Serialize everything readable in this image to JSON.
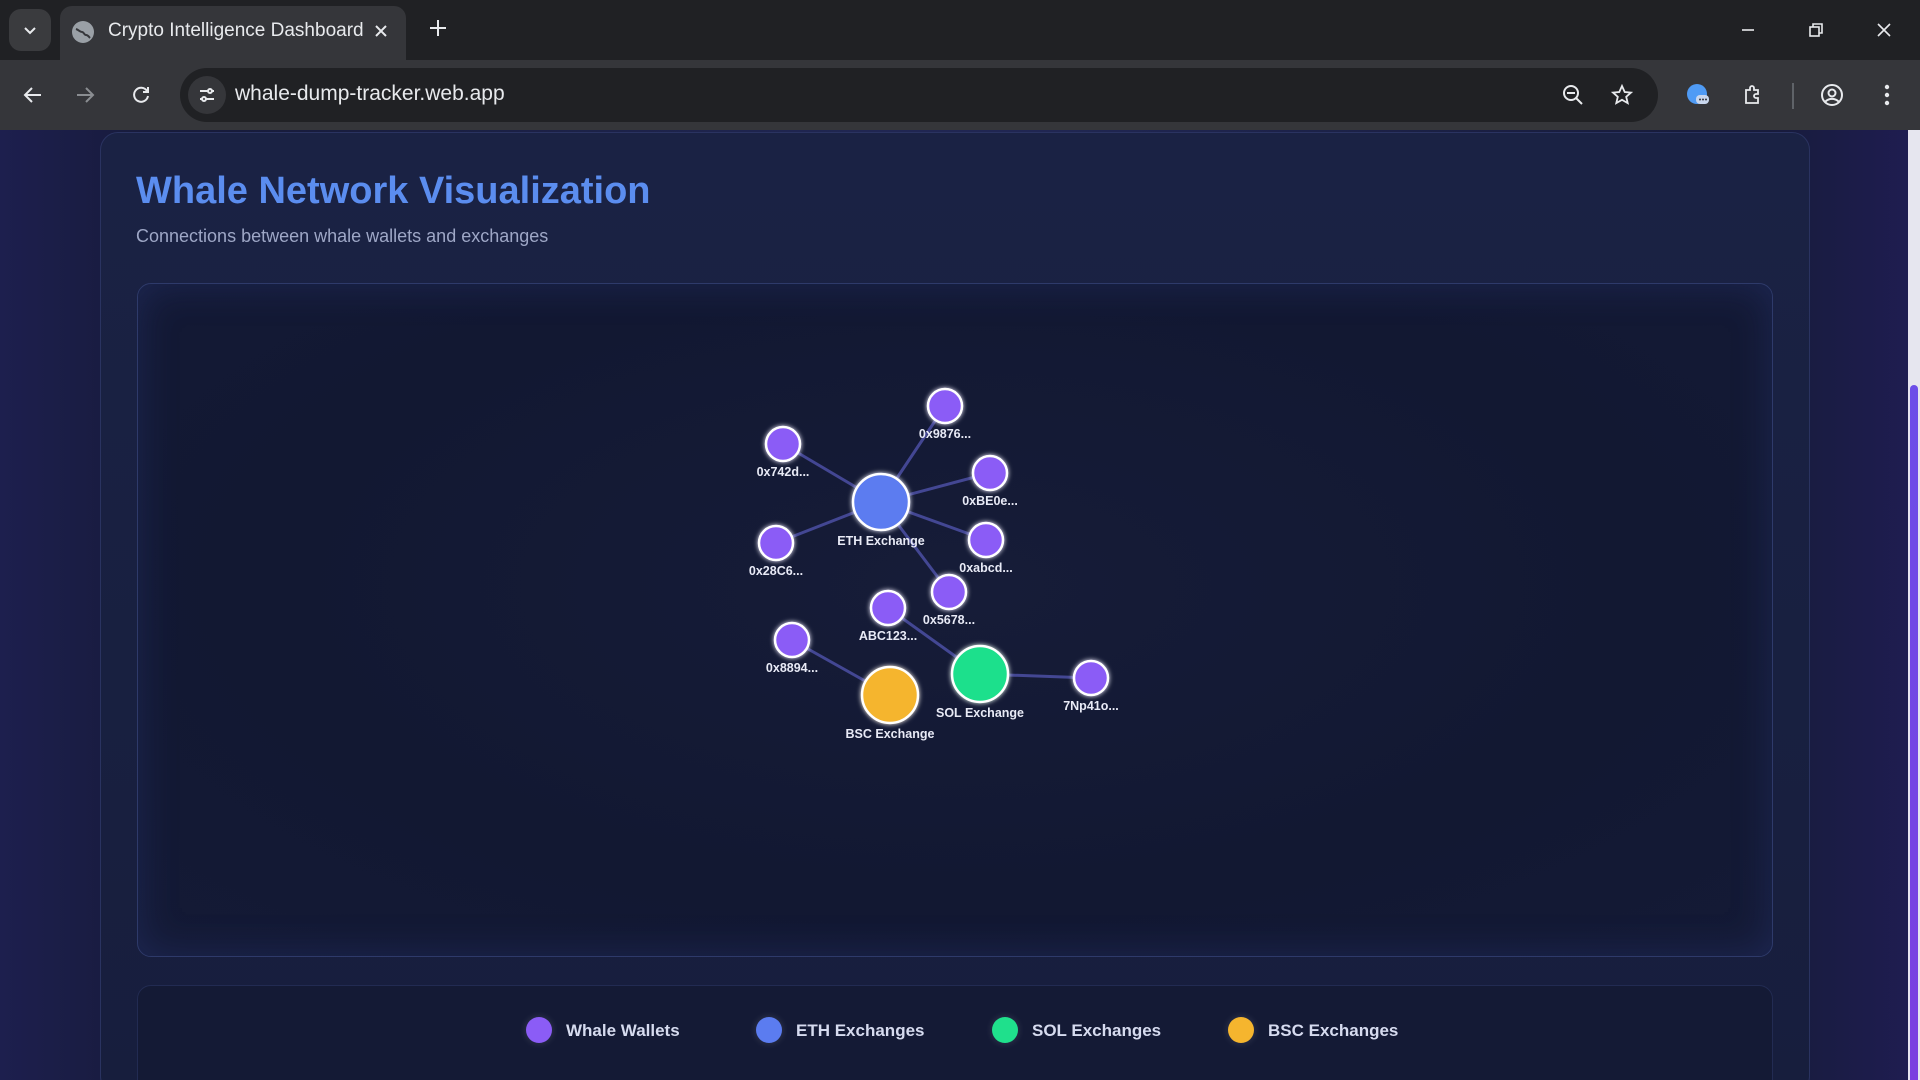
{
  "browser": {
    "tab_title": "Crypto Intelligence Dashboard",
    "url": "whale-dump-tracker.web.app"
  },
  "page": {
    "title": "Whale Network Visualization",
    "subtitle": "Connections between whale wallets and exchanges"
  },
  "colors": {
    "whale": "#8b5cf6",
    "eth": "#5b7cf0",
    "sol": "#1fe08c",
    "bsc": "#f5b52e",
    "title": "#5b8def"
  },
  "network": {
    "nodes": [
      {
        "id": "eth",
        "label": "ETH Exchange",
        "type": "eth"
      },
      {
        "id": "sol",
        "label": "SOL Exchange",
        "type": "sol"
      },
      {
        "id": "bsc",
        "label": "BSC Exchange",
        "type": "bsc"
      },
      {
        "id": "w1",
        "label": "0x9876...",
        "type": "whale"
      },
      {
        "id": "w2",
        "label": "0x742d...",
        "type": "whale"
      },
      {
        "id": "w3",
        "label": "0xBE0e...",
        "type": "whale"
      },
      {
        "id": "w4",
        "label": "0x28C6...",
        "type": "whale"
      },
      {
        "id": "w5",
        "label": "0xabcd...",
        "type": "whale"
      },
      {
        "id": "w6",
        "label": "0x5678...",
        "type": "whale"
      },
      {
        "id": "w7",
        "label": "ABC123...",
        "type": "whale"
      },
      {
        "id": "w8",
        "label": "0x8894...",
        "type": "whale"
      },
      {
        "id": "w9",
        "label": "7Np41o...",
        "type": "whale"
      }
    ],
    "edges": [
      [
        "eth",
        "w1"
      ],
      [
        "eth",
        "w2"
      ],
      [
        "eth",
        "w3"
      ],
      [
        "eth",
        "w4"
      ],
      [
        "eth",
        "w5"
      ],
      [
        "eth",
        "w6"
      ],
      [
        "sol",
        "w7"
      ],
      [
        "sol",
        "w9"
      ],
      [
        "bsc",
        "w8"
      ]
    ]
  },
  "legend": [
    {
      "label": "Whale Wallets",
      "color": "#8b5cf6"
    },
    {
      "label": "ETH Exchanges",
      "color": "#5b7cf0"
    },
    {
      "label": "SOL Exchanges",
      "color": "#1fe08c"
    },
    {
      "label": "BSC Exchanges",
      "color": "#f5b52e"
    }
  ]
}
